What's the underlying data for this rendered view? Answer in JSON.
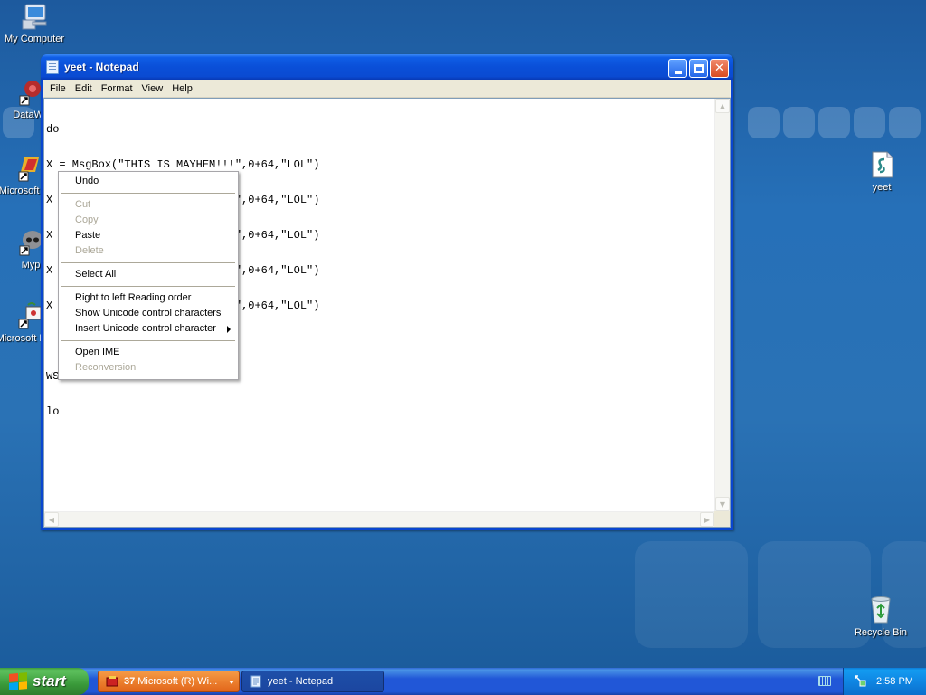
{
  "desktop": {
    "icons_left": [
      {
        "label": "My Computer",
        "icon": "computer-icon"
      },
      {
        "label": "DataWa",
        "icon": "datawa-shortcut-icon"
      },
      {
        "label": "Microsoft C++",
        "icon": "visual-cpp-shortcut-icon"
      },
      {
        "label": "Myp",
        "icon": "raccoon-shortcut-icon"
      },
      {
        "label": "Microsoft Basic",
        "icon": "visual-basic-shortcut-icon"
      }
    ],
    "icons_right": [
      {
        "label": "yeet",
        "icon": "script-file-icon"
      },
      {
        "label": "Recycle Bin",
        "icon": "recycle-bin-icon"
      }
    ]
  },
  "window": {
    "title": "yeet - Notepad",
    "menu": [
      "File",
      "Edit",
      "Format",
      "View",
      "Help"
    ],
    "lines": [
      "do",
      "X = MsgBox(\"THIS IS MAYHEM!!!\",0+64,\"LOL\")",
      "X = MsgBox(\"THIS IS MAYHEM!!!\",0+64,\"LOL\")",
      "X = MsgBox(\"THIS IS MAYHEM!!!\",0+64,\"LOL\")",
      "X = MsgBox(\"THIS IS MAYHEM!!!\",0+64,\"LOL\")",
      "X = MsgBox(\"THIS IS MAYHEM!!!\",0+64,\"LOL\")",
      "",
      "WS",
      "lo"
    ]
  },
  "context_menu": {
    "items": [
      {
        "label": "Undo",
        "enabled": true
      },
      {
        "separator": true
      },
      {
        "label": "Cut",
        "enabled": false
      },
      {
        "label": "Copy",
        "enabled": false
      },
      {
        "label": "Paste",
        "enabled": true
      },
      {
        "label": "Delete",
        "enabled": false
      },
      {
        "separator": true
      },
      {
        "label": "Select All",
        "enabled": true
      },
      {
        "separator": true
      },
      {
        "label": "Right to left Reading order",
        "enabled": true
      },
      {
        "label": "Show Unicode control characters",
        "enabled": true
      },
      {
        "label": "Insert Unicode control character",
        "enabled": true,
        "submenu": true
      },
      {
        "separator": true
      },
      {
        "label": "Open IME",
        "enabled": true
      },
      {
        "label": "Reconversion",
        "enabled": false
      }
    ]
  },
  "taskbar": {
    "start_label": "start",
    "tasks": [
      {
        "badge": "37",
        "label": "Microsoft (R) Wi...",
        "icon": "script-host-icon",
        "active": false,
        "grouped": true
      },
      {
        "label": "yeet - Notepad",
        "icon": "notepad-icon",
        "active": true
      }
    ],
    "clock": "2:58 PM"
  }
}
